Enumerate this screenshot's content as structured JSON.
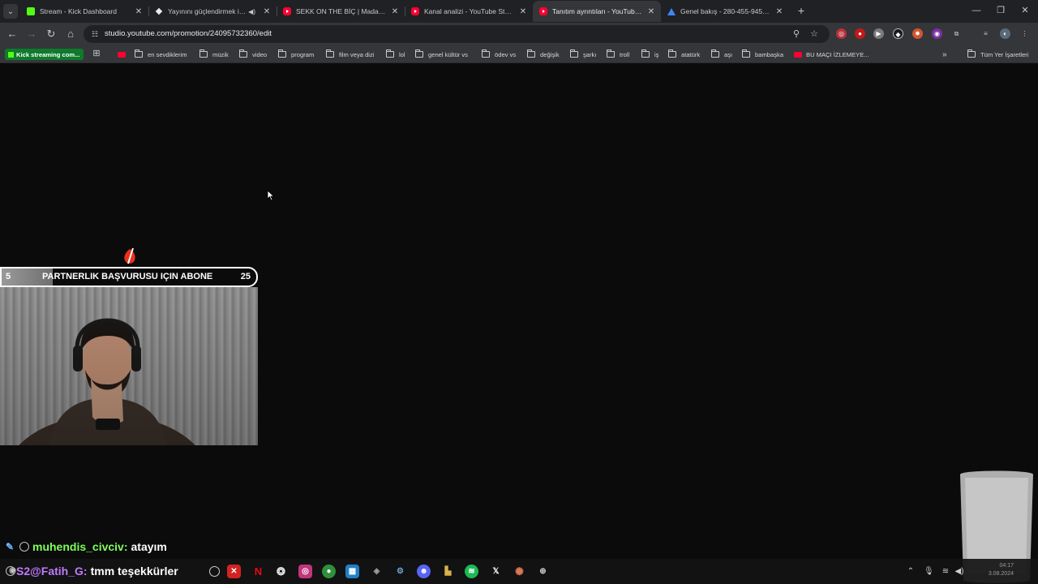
{
  "browser": {
    "tabs": [
      {
        "title": "Stream - Kick Dashboard",
        "favicon": "kick-icon",
        "active": false
      },
      {
        "title": "Yayınını güçlendirmek için e",
        "favicon": "diamond-icon",
        "active": false,
        "audio": true
      },
      {
        "title": "SEKK ON THE BİÇ | Madara Old",
        "favicon": "youtube-icon",
        "active": false
      },
      {
        "title": "Kanal analizi - YouTube Studio",
        "favicon": "youtube-icon",
        "active": false
      },
      {
        "title": "Tanıtım ayrıntıları - YouTube Stu",
        "favicon": "youtube-icon",
        "active": true
      },
      {
        "title": "Genel bakış - 280-455-9452 - G",
        "favicon": "google-ads-icon",
        "active": false
      }
    ],
    "url": "studio.youtube.com/promotion/24095732360/edit",
    "bookmarks": [
      {
        "label": "Kick streaming com...",
        "type": "kick"
      },
      {
        "label": "",
        "type": "youtube"
      },
      {
        "label": "en sevdiklerim",
        "type": "folder"
      },
      {
        "label": "müzik",
        "type": "folder"
      },
      {
        "label": "video",
        "type": "folder"
      },
      {
        "label": "program",
        "type": "folder"
      },
      {
        "label": "film veya dizi",
        "type": "folder"
      },
      {
        "label": "lol",
        "type": "folder"
      },
      {
        "label": "genel kültür vs",
        "type": "folder"
      },
      {
        "label": "ödev vs",
        "type": "folder"
      },
      {
        "label": "değişik",
        "type": "folder"
      },
      {
        "label": "şarkı",
        "type": "folder"
      },
      {
        "label": "troll",
        "type": "folder"
      },
      {
        "label": "iş",
        "type": "folder"
      },
      {
        "label": "atatürk",
        "type": "folder"
      },
      {
        "label": "aşı",
        "type": "folder"
      },
      {
        "label": "bambaşka",
        "type": "folder"
      },
      {
        "label": "BU MAÇI İZLEMEYE...",
        "type": "youtube"
      }
    ],
    "all_bookmarks": "Tüm Yer İşaretleri",
    "overflow": "»"
  },
  "overlay": {
    "goal": {
      "current": "5",
      "title": "PARTNERLIK BAŞVURUSU IÇIN ABONE",
      "target": "25",
      "progress": 0.2
    },
    "chat": [
      {
        "user": "muhendis_civciv",
        "message": "atayım",
        "user_color": "#7dff5a"
      },
      {
        "user": "S2@Fatih_G",
        "message": "tmm teşekkürler",
        "user_color": "#c07bff"
      }
    ]
  },
  "colors": {
    "page_bg": "#0b0b0b",
    "chrome_bg": "#202124",
    "toolbar_bg": "#35363a",
    "kick_green": "#53fc18",
    "youtube_red": "#ff0033"
  },
  "taskbar": {
    "apps": [
      "obs-icon",
      "speedometer-icon",
      "app-red-icon",
      "netflix-icon",
      "chatgpt-icon",
      "instagram-icon",
      "chrome-icon",
      "app-blue-icon",
      "app-gray-icon",
      "steam-icon",
      "discord-icon",
      "app-yellow-icon",
      "spotify-icon",
      "x-icon",
      "claude-icon",
      "app-circle-icon"
    ],
    "clock": {
      "time": "04:17",
      "date": "3.08.2024"
    }
  }
}
